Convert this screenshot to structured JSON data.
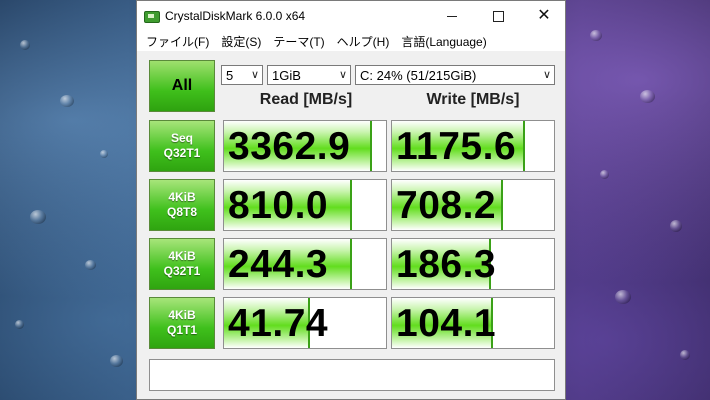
{
  "window": {
    "title": "CrystalDiskMark 6.0.0 x64",
    "controls": {
      "minimize": "minimize",
      "maximize": "maximize",
      "close": "✕"
    }
  },
  "menu": [
    "ファイル(F)",
    "設定(S)",
    "テーマ(T)",
    "ヘルプ(H)",
    "言語(Language)"
  ],
  "controls": {
    "all_label": "All",
    "count": "5",
    "size": "1GiB",
    "drive": "C: 24% (51/215GiB)"
  },
  "headers": {
    "read": "Read [MB/s]",
    "write": "Write [MB/s]"
  },
  "rows": [
    {
      "label_top": "Seq",
      "label_bottom": "Q32T1",
      "read": "3362.9",
      "write": "1175.6",
      "read_fill": 0.9,
      "write_fill": 0.81
    },
    {
      "label_top": "4KiB",
      "label_bottom": "Q8T8",
      "read": "810.0",
      "write": "708.2",
      "read_fill": 0.78,
      "write_fill": 0.67
    },
    {
      "label_top": "4KiB",
      "label_bottom": "Q32T1",
      "read": "244.3",
      "write": "186.3",
      "read_fill": 0.78,
      "write_fill": 0.6
    },
    {
      "label_top": "4KiB",
      "label_bottom": "Q1T1",
      "read": "41.74",
      "write": "104.1",
      "read_fill": 0.52,
      "write_fill": 0.61
    }
  ],
  "status": "",
  "colors": {
    "accent_green": "#3fbf1b",
    "bar_border": "#3aa117"
  }
}
